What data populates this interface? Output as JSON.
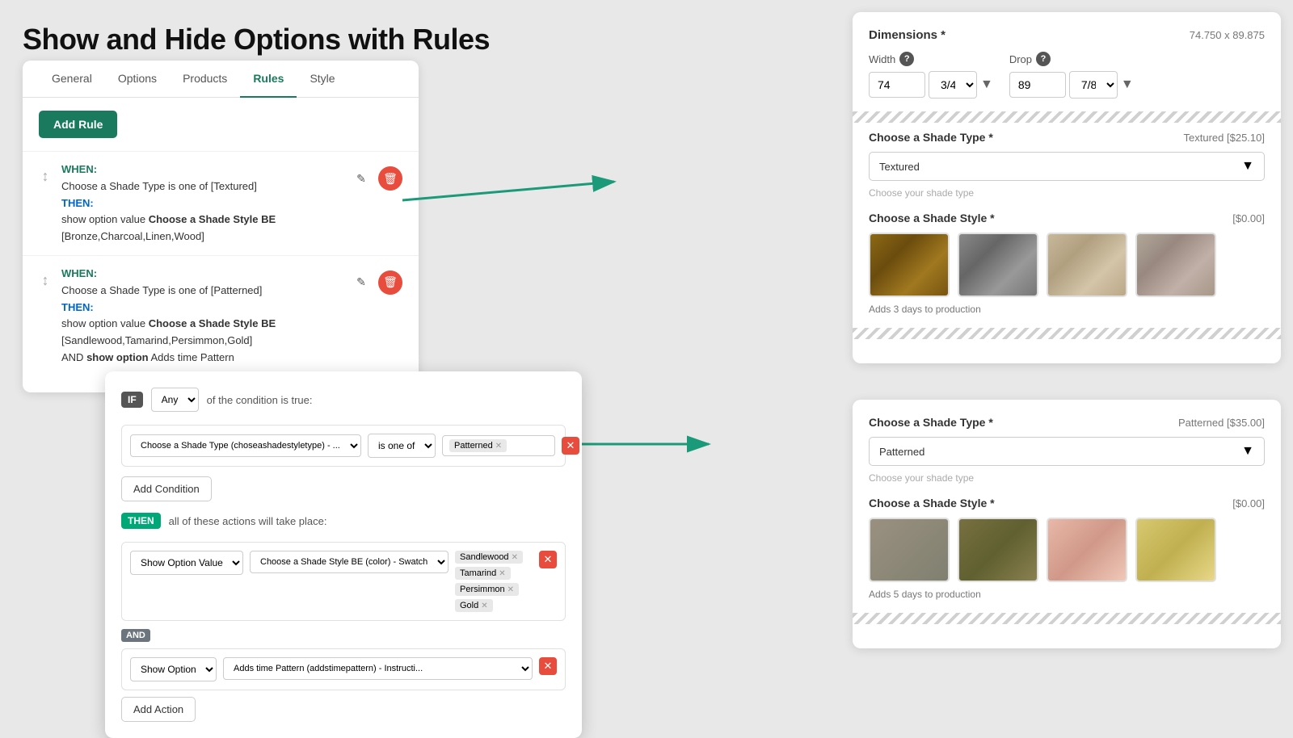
{
  "page": {
    "title": "Show and Hide Options with Rules"
  },
  "tabs": {
    "items": [
      "General",
      "Options",
      "Products",
      "Rules",
      "Style"
    ],
    "active": "Rules"
  },
  "rules_panel": {
    "add_rule_label": "Add Rule",
    "rules": [
      {
        "when_label": "WHEN:",
        "when_text": "Choose a Shade Type is one of [Textured]",
        "then_label": "THEN:",
        "then_text": "show option value Choose a Shade Style BE [Bronze,Charcoal,Linen,Wood]"
      },
      {
        "when_label": "WHEN:",
        "when_text": "Choose a Shade Type is one of [Patterned]",
        "then_label": "THEN:",
        "then_text": "show option value Choose a Shade Style BE [Sandlewood,Tamarind,Persimmon,Gold]",
        "and_text": "AND show option Adds time Pattern"
      }
    ]
  },
  "condition_modal": {
    "if_label": "IF",
    "any_label": "Any",
    "condition_text": "of the condition is true:",
    "condition_field": "Choose a Shade Type (choseashadestyletype) - ...",
    "is_one_of": "is one of",
    "tag_patterned": "Patterned",
    "then_label": "THEN",
    "all_actions_text": "all of these actions will take place:",
    "action_type": "Show Option Value",
    "action_target": "Choose a Shade Style BE (color) - Swatch",
    "tags": [
      "Sandlewood",
      "Tamarind",
      "Persimmon",
      "Gold"
    ],
    "and_label": "AND",
    "action2_type": "Show Option",
    "action2_target": "Adds time Pattern (addstimepattern) - Instructi...",
    "add_condition_label": "Add Condition",
    "add_action_label": "Add Action"
  },
  "dimensions": {
    "title": "Dimensions *",
    "value": "74.750 x 89.875",
    "width_label": "Width",
    "drop_label": "Drop",
    "width_value": "74",
    "width_fraction": "3/4",
    "drop_value": "89",
    "drop_fraction": "7/8"
  },
  "shade_type_1": {
    "title": "Choose a Shade Type *",
    "price_tag": "Textured",
    "price": "[$25.10]",
    "selected": "Textured",
    "placeholder": "Choose your shade type"
  },
  "shade_style_1": {
    "title": "Choose a Shade Style *",
    "price": "[$0.00]",
    "notice": "Adds 3 days to production"
  },
  "shade_type_2": {
    "title": "Choose a Shade Type *",
    "price_tag": "Patterned",
    "price": "[$35.00]",
    "selected": "Patterned",
    "placeholder": "Choose your shade type"
  },
  "shade_style_2": {
    "title": "Choose a Shade Style *",
    "price": "[$0.00]",
    "notice": "Adds 5 days to production"
  }
}
